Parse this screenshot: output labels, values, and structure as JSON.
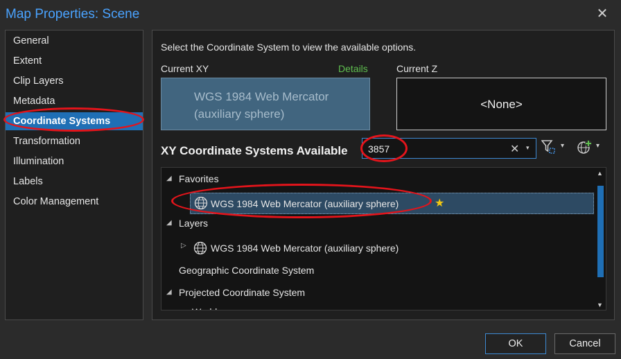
{
  "window": {
    "title": "Map Properties: Scene"
  },
  "sidebar": {
    "items": [
      {
        "label": "General",
        "active": false
      },
      {
        "label": "Extent",
        "active": false
      },
      {
        "label": "Clip Layers",
        "active": false
      },
      {
        "label": "Metadata",
        "active": false
      },
      {
        "label": "Coordinate Systems",
        "active": true
      },
      {
        "label": "Transformation",
        "active": false
      },
      {
        "label": "Illumination",
        "active": false
      },
      {
        "label": "Labels",
        "active": false
      },
      {
        "label": "Color Management",
        "active": false
      }
    ]
  },
  "main": {
    "instruction": "Select the Coordinate System to view the available options.",
    "current_xy": {
      "label": "Current XY",
      "details": "Details",
      "value": "WGS 1984 Web Mercator (auxiliary sphere)"
    },
    "current_z": {
      "label": "Current Z",
      "value": "<None>"
    },
    "available": {
      "heading": "XY Coordinate Systems Available",
      "search_value": "3857",
      "icons": {
        "filter": "filter-icon",
        "add": "add-globe-icon"
      }
    },
    "tree": {
      "favorites": {
        "label": "Favorites",
        "item": "WGS 1984 Web Mercator (auxiliary sphere)"
      },
      "layers": {
        "label": "Layers",
        "item": "WGS 1984 Web Mercator (auxiliary sphere)"
      },
      "geographic": {
        "label": "Geographic Coordinate System"
      },
      "projected": {
        "label": "Projected Coordinate System"
      },
      "cutoff": {
        "label": "World"
      }
    }
  },
  "footer": {
    "ok": "OK",
    "cancel": "Cancel"
  },
  "colors": {
    "accent": "#1f6fb5",
    "title": "#4aa3ff",
    "details": "#5fbf4f",
    "annotation": "#e3141b",
    "star": "#f2c811"
  }
}
